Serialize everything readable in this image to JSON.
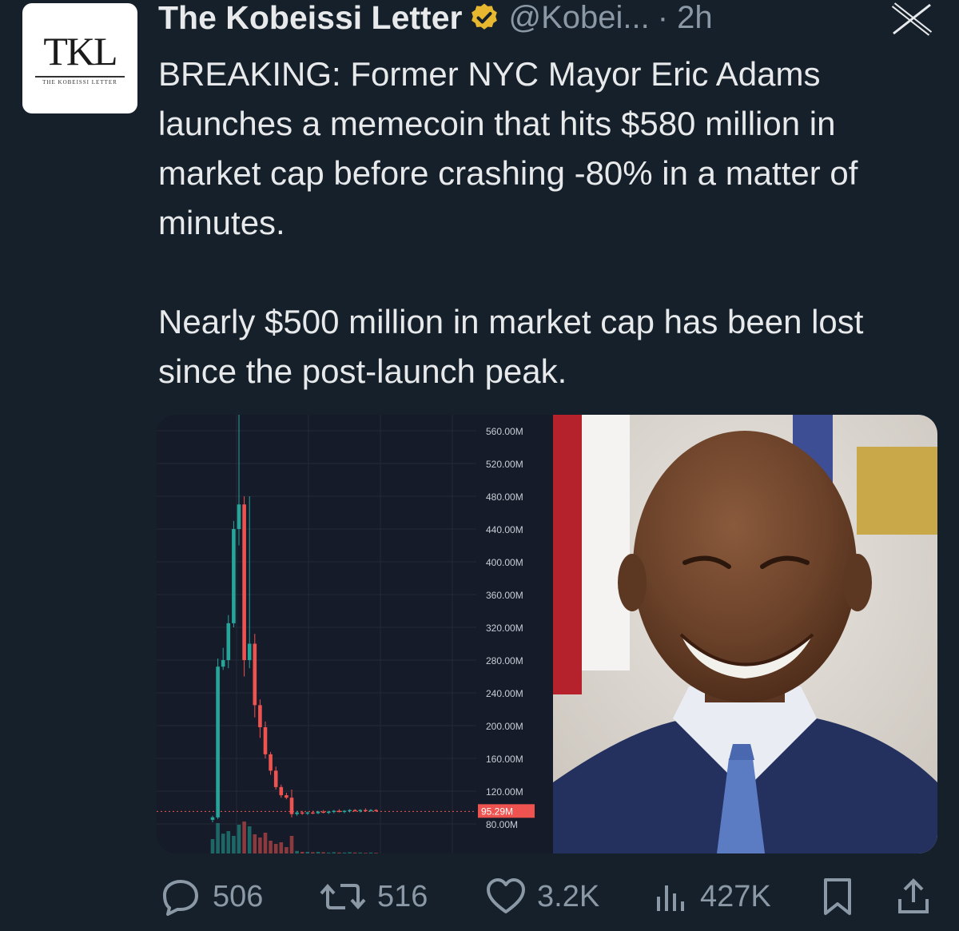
{
  "tweet": {
    "author": {
      "name": "The Kobeissi Letter",
      "handle": "@Kobei...",
      "time": "· 2h",
      "avatar_monogram": "TKL",
      "avatar_subtitle": "THE KOBEISSI LETTER"
    },
    "paragraphs": [
      "BREAKING: Former NYC Mayor Eric Adams launches a memecoin that hits $580 million in market cap before crashing -80% in a matter of minutes.",
      "Nearly $500 million in market cap has been lost since the post-launch peak."
    ],
    "actions": {
      "replies": "506",
      "reposts": "516",
      "likes": "3.2K",
      "views": "427K"
    }
  },
  "icons": {
    "verified": "verified-badge-icon",
    "close": "x-logo-icon",
    "reply": "reply-icon",
    "repost": "repost-icon",
    "like": "heart-icon",
    "views": "views-icon",
    "bookmark": "bookmark-icon",
    "share": "share-icon"
  },
  "colors": {
    "background": "#15202b",
    "text": "#e7e9ea",
    "muted": "#8b98a5",
    "badge": "#e8b730",
    "up": "#26a69a",
    "down": "#ef5350"
  },
  "chart_data": {
    "type": "candlestick",
    "title": "",
    "ylim": [
      80,
      580
    ],
    "y_ticks": [
      "560.00M",
      "520.00M",
      "480.00M",
      "440.00M",
      "400.00M",
      "360.00M",
      "320.00M",
      "280.00M",
      "240.00M",
      "200.00M",
      "160.00M",
      "120.00M",
      "80.00M"
    ],
    "tick_values": [
      560,
      520,
      480,
      440,
      400,
      360,
      320,
      280,
      240,
      200,
      160,
      120,
      80
    ],
    "current_price_label": "95.29M",
    "current_price": 95.29,
    "candles": [
      {
        "o": 85,
        "h": 90,
        "l": 82,
        "c": 88
      },
      {
        "o": 88,
        "h": 282,
        "l": 86,
        "c": 272
      },
      {
        "o": 272,
        "h": 295,
        "l": 268,
        "c": 280
      },
      {
        "o": 280,
        "h": 335,
        "l": 270,
        "c": 325
      },
      {
        "o": 325,
        "h": 450,
        "l": 320,
        "c": 440
      },
      {
        "o": 440,
        "h": 580,
        "l": 420,
        "c": 470
      },
      {
        "o": 470,
        "h": 480,
        "l": 260,
        "c": 280
      },
      {
        "o": 280,
        "h": 480,
        "l": 270,
        "c": 300
      },
      {
        "o": 300,
        "h": 312,
        "l": 210,
        "c": 225
      },
      {
        "o": 225,
        "h": 232,
        "l": 185,
        "c": 198
      },
      {
        "o": 198,
        "h": 205,
        "l": 160,
        "c": 165
      },
      {
        "o": 165,
        "h": 168,
        "l": 140,
        "c": 145
      },
      {
        "o": 145,
        "h": 150,
        "l": 122,
        "c": 125
      },
      {
        "o": 125,
        "h": 128,
        "l": 112,
        "c": 115
      },
      {
        "o": 115,
        "h": 118,
        "l": 110,
        "c": 112
      },
      {
        "o": 112,
        "h": 122,
        "l": 88,
        "c": 92
      },
      {
        "o": 92,
        "h": 96,
        "l": 90,
        "c": 94
      },
      {
        "o": 94,
        "h": 96,
        "l": 91,
        "c": 93
      },
      {
        "o": 93,
        "h": 95,
        "l": 91,
        "c": 94
      },
      {
        "o": 94,
        "h": 96,
        "l": 92,
        "c": 93
      },
      {
        "o": 93,
        "h": 96,
        "l": 92,
        "c": 95
      },
      {
        "o": 95,
        "h": 97,
        "l": 93,
        "c": 94
      },
      {
        "o": 94,
        "h": 96,
        "l": 92,
        "c": 95
      },
      {
        "o": 95,
        "h": 97,
        "l": 93,
        "c": 96
      },
      {
        "o": 96,
        "h": 98,
        "l": 94,
        "c": 95
      },
      {
        "o": 95,
        "h": 97,
        "l": 93,
        "c": 96
      },
      {
        "o": 96,
        "h": 98,
        "l": 94,
        "c": 97
      },
      {
        "o": 97,
        "h": 98,
        "l": 95,
        "c": 96
      },
      {
        "o": 96,
        "h": 98,
        "l": 94,
        "c": 97
      },
      {
        "o": 97,
        "h": 99,
        "l": 95,
        "c": 96
      },
      {
        "o": 96,
        "h": 98,
        "l": 95,
        "c": 97
      },
      {
        "o": 97,
        "h": 98,
        "l": 95,
        "c": 96
      }
    ],
    "volume": [
      0.45,
      0.95,
      0.62,
      0.7,
      0.55,
      0.9,
      1.0,
      0.85,
      0.6,
      0.5,
      0.65,
      0.4,
      0.3,
      0.35,
      0.2,
      0.55,
      0.08,
      0.05,
      0.05,
      0.04,
      0.05,
      0.04,
      0.03,
      0.04,
      0.03,
      0.03,
      0.04,
      0.03,
      0.03,
      0.02,
      0.03,
      0.02
    ]
  }
}
